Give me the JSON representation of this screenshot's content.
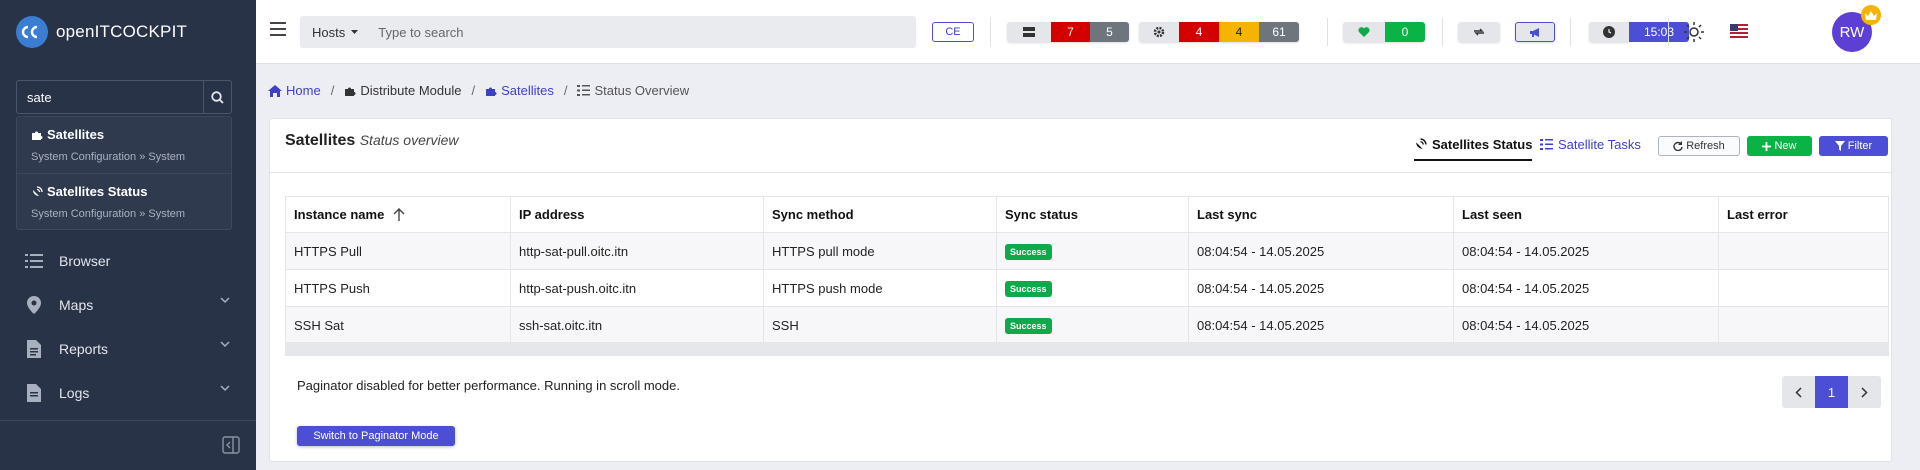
{
  "app": {
    "name": "openITCOCKPIT"
  },
  "sidebar": {
    "search_value": "sate",
    "results": [
      {
        "title": "Satellites",
        "path": "System Configuration » System"
      },
      {
        "title": "Satellites Status",
        "path": "System Configuration » System"
      }
    ],
    "items": [
      {
        "label": "Browser",
        "icon": "list-icon"
      },
      {
        "label": "Maps",
        "icon": "map-pin-icon"
      },
      {
        "label": "Reports",
        "icon": "file-report-icon"
      },
      {
        "label": "Logs",
        "icon": "log-file-icon"
      }
    ]
  },
  "header": {
    "search_type": "Hosts",
    "search_placeholder": "Type to search",
    "edition": "CE",
    "host_counts": {
      "critical": "7",
      "unknown": "5"
    },
    "service_counts": {
      "critical": "4",
      "warning": "4",
      "unknown": "61"
    },
    "ok_count": "0",
    "time": "15:03",
    "user_initials": "RW"
  },
  "breadcrumb": {
    "home": "Home",
    "module": "Distribute Module",
    "satellites": "Satellites",
    "current": "Status Overview"
  },
  "card": {
    "title": "Satellites",
    "subtitle": "Status overview",
    "tab_status": "Satellites Status",
    "tab_tasks": "Satellite Tasks",
    "refresh": "Refresh",
    "new": "New",
    "filter": "Filter"
  },
  "table": {
    "headers": [
      "Instance name",
      "IP address",
      "Sync method",
      "Sync status",
      "Last sync",
      "Last seen",
      "Last error"
    ],
    "rows": [
      {
        "name": "HTTPS Pull",
        "ip": "http-sat-pull.oitc.itn",
        "method": "HTTPS pull mode",
        "status": "Success",
        "last_sync": "08:04:54 - 14.05.2025",
        "last_seen": "08:04:54 - 14.05.2025",
        "last_error": ""
      },
      {
        "name": "HTTPS Push",
        "ip": "http-sat-push.oitc.itn",
        "method": "HTTPS push mode",
        "status": "Success",
        "last_sync": "08:04:54 - 14.05.2025",
        "last_seen": "08:04:54 - 14.05.2025",
        "last_error": ""
      },
      {
        "name": "SSH Sat",
        "ip": "ssh-sat.oitc.itn",
        "method": "SSH",
        "status": "Success",
        "last_sync": "08:04:54 - 14.05.2025",
        "last_seen": "08:04:54 - 14.05.2025",
        "last_error": ""
      }
    ]
  },
  "paginator": {
    "note": "Paginator disabled for better performance. Running in scroll mode.",
    "current_page": "1",
    "switch_label": "Switch to Paginator Mode"
  },
  "colors": {
    "accent": "#4c4ed6",
    "success": "#0fa84a",
    "danger": "#d40000",
    "warning": "#f5b400",
    "sidebar": "#283347"
  }
}
